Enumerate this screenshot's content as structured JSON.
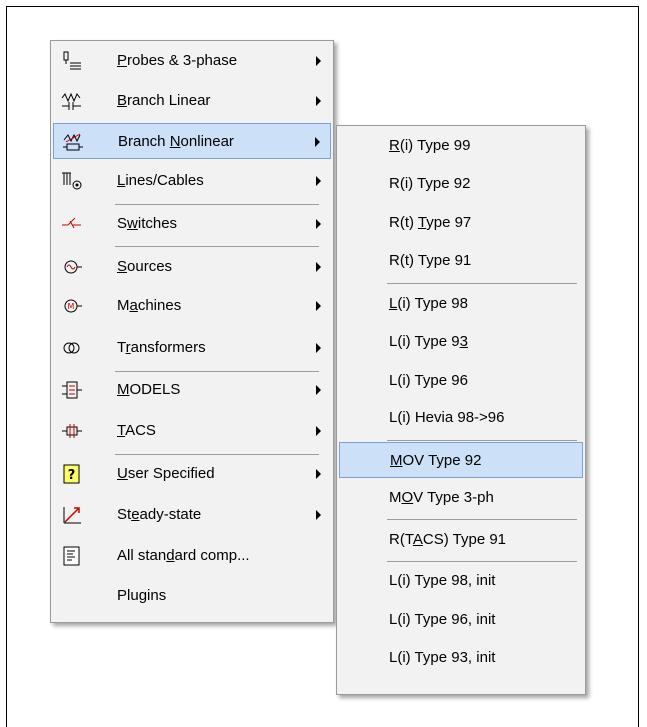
{
  "main_menu": {
    "items": [
      {
        "pre": "",
        "acc": "P",
        "post": "robes & 3-phase",
        "submenu": true
      },
      {
        "pre": "",
        "acc": "B",
        "post": "ranch Linear",
        "submenu": true
      },
      {
        "pre": "Branch ",
        "acc": "N",
        "post": "onlinear",
        "submenu": true
      },
      {
        "pre": "",
        "acc": "L",
        "post": "ines/Cables",
        "submenu": true
      },
      {
        "pre": "S",
        "acc": "w",
        "post": "itches",
        "submenu": true
      },
      {
        "pre": "",
        "acc": "S",
        "post": "ources",
        "submenu": true
      },
      {
        "pre": "M",
        "acc": "a",
        "post": "chines",
        "submenu": true
      },
      {
        "pre": "T",
        "acc": "r",
        "post": "ansformers",
        "submenu": true
      },
      {
        "pre": "",
        "acc": "M",
        "post": "ODELS",
        "submenu": true
      },
      {
        "pre": "",
        "acc": "T",
        "post": "ACS",
        "submenu": true
      },
      {
        "pre": "",
        "acc": "U",
        "post": "ser Specified",
        "submenu": true
      },
      {
        "pre": "St",
        "acc": "e",
        "post": "ady-state",
        "submenu": true
      },
      {
        "pre": "All stan",
        "acc": "d",
        "post": "ard comp...",
        "submenu": false
      },
      {
        "pre": "Plu",
        "acc": "g",
        "post": "ins",
        "submenu": false
      }
    ],
    "highlighted_index": 2,
    "icons": [
      "probe-icon",
      "branch-linear-icon",
      "branch-nonlinear-icon",
      "lines-cables-icon",
      "switch-icon",
      "source-icon",
      "machine-icon",
      "transformer-icon",
      "models-icon",
      "tacs-icon",
      "user-specified-icon",
      "steady-state-icon",
      "all-standard-components-icon",
      ""
    ]
  },
  "sub_menu": {
    "items": [
      {
        "pre": "",
        "acc": "R",
        "post": "(i) Type 99"
      },
      {
        "pre": "R(i) Type 92",
        "acc": "",
        "post": ""
      },
      {
        "pre": "R(t) ",
        "acc": "T",
        "post": "ype 97"
      },
      {
        "pre": "R(t) Type 91",
        "acc": "",
        "post": ""
      },
      {
        "pre": "",
        "acc": "L",
        "post": "(i) Type 98"
      },
      {
        "pre": "L(i) Type 9",
        "acc": "3",
        "post": ""
      },
      {
        "pre": "L(i) Type 96",
        "acc": "",
        "post": ""
      },
      {
        "pre": "L(i) Hevia 98->96",
        "acc": "",
        "post": ""
      },
      {
        "pre": "",
        "acc": "M",
        "post": "OV Type 92"
      },
      {
        "pre": "M",
        "acc": "O",
        "post": "V Type 3-ph"
      },
      {
        "pre": "R(T",
        "acc": "A",
        "post": "CS) Type 91"
      },
      {
        "pre": "L(i) Type 98, init",
        "acc": "",
        "post": ""
      },
      {
        "pre": "L(i) Type 96, init",
        "acc": "",
        "post": ""
      },
      {
        "pre": "L(i) Type 93, init",
        "acc": "",
        "post": ""
      }
    ],
    "highlighted_index": 8
  },
  "colors": {
    "menu_bg": "#f2f2f2",
    "highlight_bg": "#cce0f7",
    "highlight_border": "#7da2ce"
  }
}
